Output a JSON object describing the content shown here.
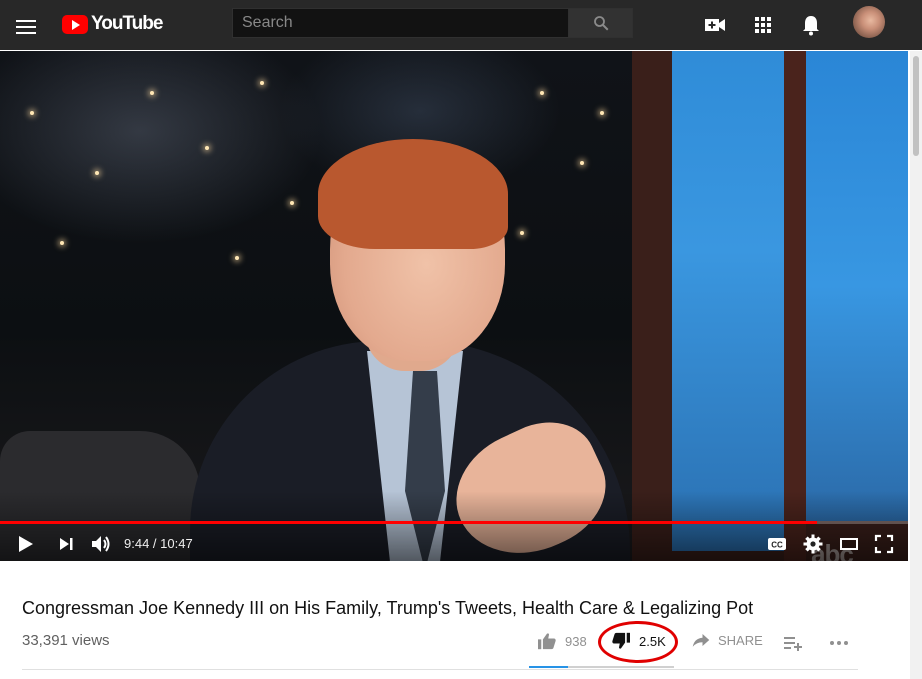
{
  "header": {
    "logo_text": "YouTube",
    "search_placeholder": "Search",
    "icons": [
      "menu-icon",
      "youtube-logo-icon",
      "search-icon",
      "create-video-icon",
      "apps-grid-icon",
      "notifications-bell-icon",
      "avatar"
    ]
  },
  "player": {
    "current_time": "9:44",
    "duration": "10:47",
    "time_display": "9:44 / 10:47",
    "progress": 0.9,
    "watermark": "abc",
    "controls": [
      "play-icon",
      "next-icon",
      "volume-icon",
      "captions-icon",
      "settings-gear-icon",
      "theater-mode-icon",
      "fullscreen-icon"
    ]
  },
  "video": {
    "title": "Congressman Joe Kennedy III on His Family, Trump's Tweets, Health Care & Legalizing Pot",
    "views": "33,391 views",
    "likes": "938",
    "dislikes": "2.5K",
    "like_ratio": 0.27,
    "share_label": "SHARE"
  },
  "colors": {
    "masthead": "#282828",
    "brand_red": "#ff0000",
    "annotation_circle": "#e00000",
    "like_bar": "#2793e6"
  }
}
